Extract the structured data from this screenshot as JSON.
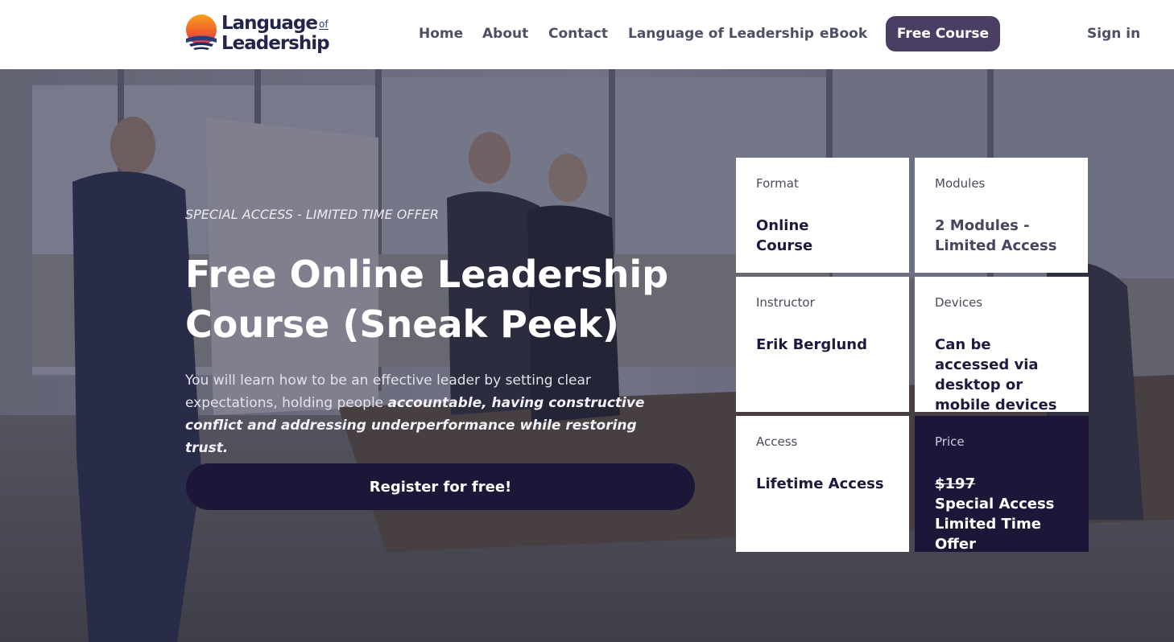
{
  "header": {
    "logo": {
      "line1": "Language",
      "of": "of",
      "line2": "Leadership"
    },
    "nav": [
      {
        "label": "Home"
      },
      {
        "label": "About"
      },
      {
        "label": "Contact"
      },
      {
        "label": "Language of Leadership"
      },
      {
        "label": "eBook"
      }
    ],
    "cta_label": "Free Course",
    "sign_in_label": "Sign in"
  },
  "hero": {
    "eyebrow": "SPECIAL ACCESS - LIMITED TIME OFFER",
    "title": "Free Online Leadership Course (Sneak Peek)",
    "description_plain": "You will learn how to be an effective leader by setting clear expectations, holding people ",
    "description_emphasis": "accountable, having constructive conflict and addressing underperformance while restoring trust.",
    "register_label": "Register for free!"
  },
  "details": {
    "format": {
      "label": "Format",
      "value": "Online Course"
    },
    "modules": {
      "label": "Modules",
      "value": "2 Modules - Limited Access"
    },
    "instructor": {
      "label": "Instructor",
      "value": "Erik Berglund"
    },
    "devices": {
      "label": "Devices",
      "value": "Can be accessed via desktop or mobile devices"
    },
    "access": {
      "label": "Access",
      "value": "Lifetime Access"
    },
    "price": {
      "label": "Price",
      "original": "$197",
      "offer_line1": "Special Access",
      "offer_line2": "Limited Time Offer"
    }
  },
  "colors": {
    "brand_dark": "#1e1638",
    "cta_purple": "#4a3f63",
    "nav_text": "#4b5066"
  }
}
